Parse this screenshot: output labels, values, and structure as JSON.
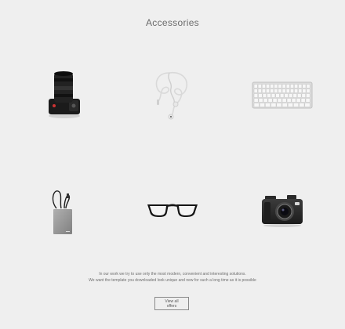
{
  "section": {
    "title": "Accessories"
  },
  "products": [
    {
      "name": "dslr camera",
      "icon": "dslr-camera-icon"
    },
    {
      "name": "earphones",
      "icon": "earphones-icon"
    },
    {
      "name": "keyboard",
      "icon": "keyboard-icon"
    },
    {
      "name": "external hard drive",
      "icon": "hard-drive-icon"
    },
    {
      "name": "glasses",
      "icon": "glasses-icon"
    },
    {
      "name": "compact camera",
      "icon": "compact-camera-icon"
    }
  ],
  "description": {
    "line1": "In our work we try to use only the most modern, convenient and interesting solutions.",
    "line2": "We want the template you downloaded look unique and new for such a long time as it is possible"
  },
  "cta": {
    "label": "View all offers"
  },
  "colors": {
    "background": "#efefef",
    "text": "#555555",
    "button_border": "#8a8a8a"
  }
}
